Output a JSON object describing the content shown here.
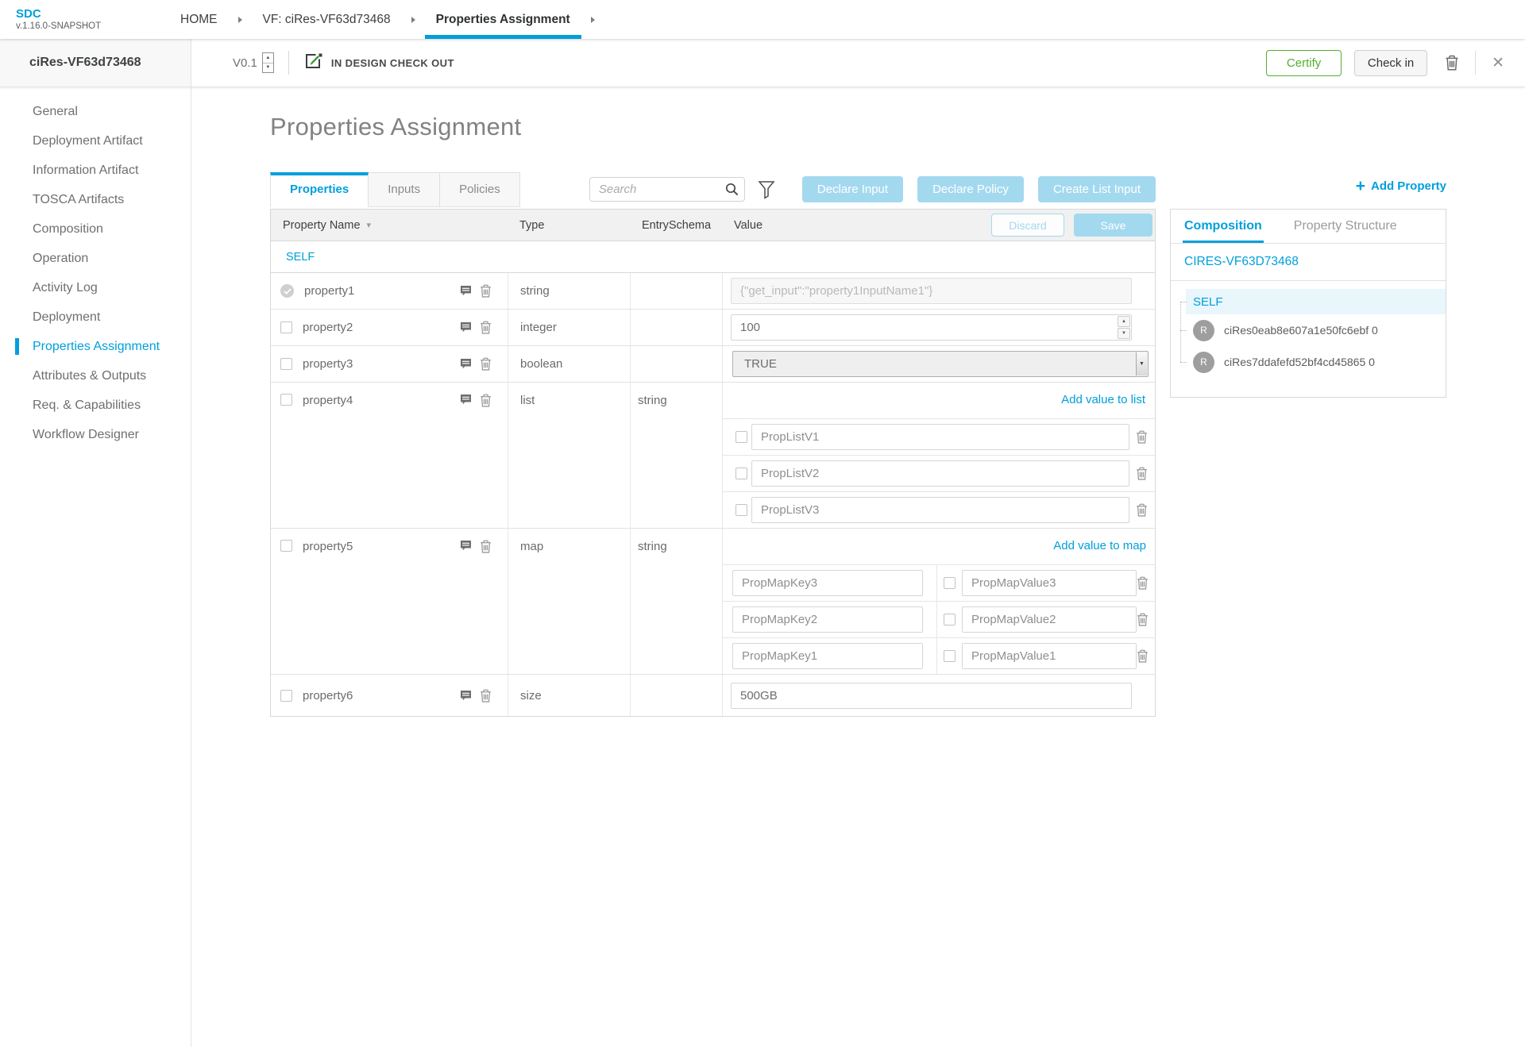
{
  "app": {
    "logo": "SDC",
    "version": "v.1.16.0-SNAPSHOT"
  },
  "breadcrumbs": [
    {
      "label": "HOME",
      "active": false
    },
    {
      "label": "VF: ciRes-VF63d73468",
      "active": false
    },
    {
      "label": "Properties Assignment",
      "active": true
    }
  ],
  "header": {
    "entity_name": "ciRes-VF63d73468",
    "version": "V0.1",
    "status": "IN DESIGN CHECK OUT",
    "certify_label": "Certify",
    "checkin_label": "Check in"
  },
  "sidebar": {
    "items": [
      {
        "label": "General",
        "active": false
      },
      {
        "label": "Deployment Artifact",
        "active": false
      },
      {
        "label": "Information Artifact",
        "active": false
      },
      {
        "label": "TOSCA Artifacts",
        "active": false
      },
      {
        "label": "Composition",
        "active": false
      },
      {
        "label": "Operation",
        "active": false
      },
      {
        "label": "Activity Log",
        "active": false
      },
      {
        "label": "Deployment",
        "active": false
      },
      {
        "label": "Properties Assignment",
        "active": true
      },
      {
        "label": "Attributes & Outputs",
        "active": false
      },
      {
        "label": "Req. & Capabilities",
        "active": false
      },
      {
        "label": "Workflow Designer",
        "active": false
      }
    ]
  },
  "main": {
    "title": "Properties Assignment",
    "tabs": [
      {
        "label": "Properties",
        "active": true
      },
      {
        "label": "Inputs",
        "active": false
      },
      {
        "label": "Policies",
        "active": false
      }
    ],
    "search_placeholder": "Search",
    "action_buttons": [
      "Declare Input",
      "Declare Policy",
      "Create List Input"
    ],
    "add_property": {
      "plus": "+",
      "label": "Add Property"
    }
  },
  "table": {
    "columns": [
      "Property Name",
      "Type",
      "EntrySchema",
      "Value"
    ],
    "sort_caret": "▾",
    "discard_label": "Discard",
    "save_label": "Save",
    "group_label": "SELF",
    "rows": [
      {
        "name": "property1",
        "type": "string",
        "entry_schema": "",
        "control": "disabled-text",
        "value": "{\"get_input\":\"property1InputName1\"}",
        "checked": true
      },
      {
        "name": "property2",
        "type": "integer",
        "entry_schema": "",
        "control": "number",
        "value": "100"
      },
      {
        "name": "property3",
        "type": "boolean",
        "entry_schema": "",
        "control": "select",
        "value": "TRUE"
      },
      {
        "name": "property4",
        "type": "list",
        "entry_schema": "string",
        "control": "list",
        "add_label": "Add value to list",
        "items": [
          "PropListV1",
          "PropListV2",
          "PropListV3"
        ]
      },
      {
        "name": "property5",
        "type": "map",
        "entry_schema": "string",
        "control": "map",
        "add_label": "Add value to map",
        "items": [
          {
            "key": "PropMapKey3",
            "value": "PropMapValue3"
          },
          {
            "key": "PropMapKey2",
            "value": "PropMapValue2"
          },
          {
            "key": "PropMapKey1",
            "value": "PropMapValue1"
          }
        ]
      },
      {
        "name": "property6",
        "type": "size",
        "entry_schema": "",
        "control": "text",
        "value": "500GB"
      }
    ]
  },
  "panel": {
    "tabs": [
      {
        "label": "Composition",
        "active": true
      },
      {
        "label": "Property Structure",
        "active": false
      }
    ],
    "component_name": "CIRES-VF63D73468",
    "tree": {
      "root": "SELF",
      "avatar_letter": "R",
      "children": [
        "ciRes0eab8e607a1e50fc6ebf 0",
        "ciRes7ddafefd52bf4cd45865 0"
      ]
    }
  },
  "colors": {
    "accent": "#009fdb",
    "light_blue_button": "#a3d9ef",
    "certify_green": "#52ae30"
  }
}
